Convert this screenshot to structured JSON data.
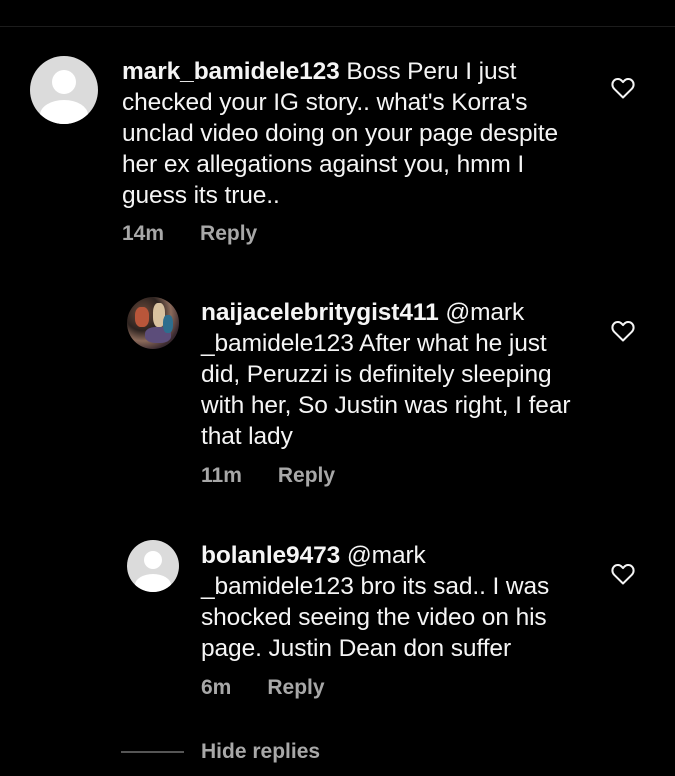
{
  "comments": [
    {
      "username": "mark_bamidele123",
      "mention": "",
      "text": "Boss Peru I just checked your IG story.. what's Korra's unclad video doing on your page despite her ex allegations against you, hmm I guess its true..",
      "time": "14m",
      "reply_label": "Reply",
      "avatar": "default-avatar"
    },
    {
      "username": "naijacelebritygist411",
      "mention": "@mark _bamidele123",
      "text": "After what he just did,  Peruzzi is definitely sleeping with her, So Justin was right, I fear that lady",
      "time": "11m",
      "reply_label": "Reply",
      "avatar": "photo-avatar"
    },
    {
      "username": "bolanle9473",
      "mention": "@mark _bamidele123",
      "text": "bro its sad.. I was shocked seeing the video on his page. Justin Dean don suffer",
      "time": "6m",
      "reply_label": "Reply",
      "avatar": "default-avatar"
    }
  ],
  "hide_replies_label": "Hide replies",
  "icons": {
    "like": "heart-outline-icon"
  },
  "colors": {
    "background": "#000000",
    "text": "#f5f5f5",
    "meta": "#a8a8a8"
  }
}
